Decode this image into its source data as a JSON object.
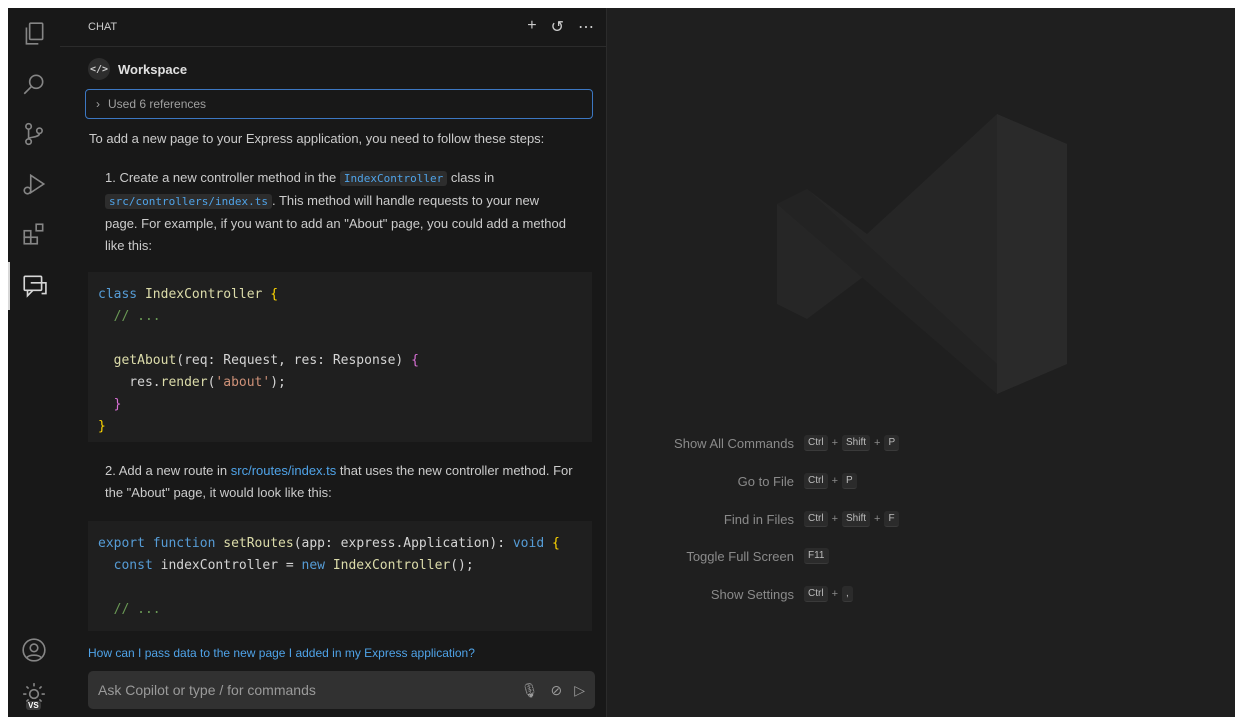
{
  "chat": {
    "header_title": "CHAT",
    "agent_label": "Workspace",
    "references_label": "Used 6 references",
    "intro": "To add a new page to your Express application, you need to follow these steps:",
    "step1": {
      "prefix": "1. Create a new controller method in the",
      "class_code": "IndexController",
      "mid": "class in",
      "path_code": "src/controllers/index.ts",
      "suffix": ". This method will handle requests to your new page. For example, if you want to add an \"About\" page, you could add a method like this:"
    },
    "step2": {
      "prefix": "2. Add a new route in",
      "link": "src/routes/index.ts",
      "suffix": "that uses the new controller method. For the \"About\" page, it would look like this:"
    },
    "suggestion": "How can I pass data to the new page I added in my Express application?",
    "input_placeholder": "Ask Copilot or type / for commands"
  },
  "editor": {
    "shortcuts": [
      {
        "label": "Show All Commands",
        "keys": [
          "Ctrl",
          "Shift",
          "P"
        ]
      },
      {
        "label": "Go to File",
        "keys": [
          "Ctrl",
          "P"
        ]
      },
      {
        "label": "Find in Files",
        "keys": [
          "Ctrl",
          "Shift",
          "F"
        ]
      },
      {
        "label": "Toggle Full Screen",
        "keys": [
          "F11"
        ]
      },
      {
        "label": "Show Settings",
        "keys": [
          "Ctrl",
          ","
        ]
      }
    ]
  },
  "accounts_badge": "VS",
  "colors": {
    "accent": "#4fa3e8",
    "background": "#1f1f1f",
    "sidebar": "#181818"
  },
  "icons": [
    "explorer-icon",
    "search-icon",
    "source-control-icon",
    "run-debug-icon",
    "extensions-icon",
    "chat-icon",
    "account-icon",
    "manage-gear-icon"
  ]
}
